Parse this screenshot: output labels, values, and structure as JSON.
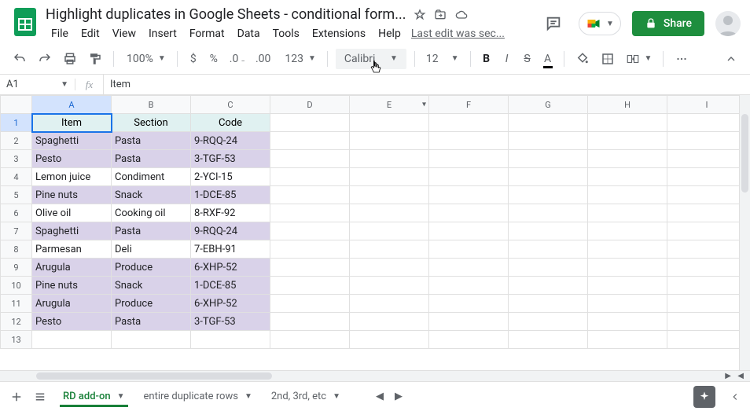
{
  "header": {
    "doc_title": "Highlight duplicates in Google Sheets - conditional form...",
    "last_edit": "Last edit was sec...",
    "share_label": "Share"
  },
  "menus": [
    "File",
    "Edit",
    "View",
    "Insert",
    "Format",
    "Data",
    "Tools",
    "Extensions",
    "Help"
  ],
  "toolbar": {
    "zoom": "100%",
    "font": "Calibri",
    "font_size": "12",
    "more_formats": "123"
  },
  "namebox": "A1",
  "formula": "Item",
  "columns": [
    "A",
    "B",
    "C",
    "D",
    "E",
    "F",
    "G",
    "H",
    "I"
  ],
  "rows_count": 13,
  "table": {
    "headers": [
      "Item",
      "Section",
      "Code"
    ],
    "data": [
      {
        "item": "Spaghetti",
        "section": "Pasta",
        "code": "9-RQQ-24",
        "dup": true
      },
      {
        "item": "Pesto",
        "section": "Pasta",
        "code": "3-TGF-53",
        "dup": true
      },
      {
        "item": "Lemon juice",
        "section": "Condiment",
        "code": "2-YCI-15",
        "dup": false
      },
      {
        "item": "Pine nuts",
        "section": "Snack",
        "code": "1-DCE-85",
        "dup": true
      },
      {
        "item": "Olive oil",
        "section": "Cooking oil",
        "code": "8-RXF-92",
        "dup": false
      },
      {
        "item": "Spaghetti",
        "section": "Pasta",
        "code": "9-RQQ-24",
        "dup": true
      },
      {
        "item": "Parmesan",
        "section": "Deli",
        "code": "7-EBH-91",
        "dup": false
      },
      {
        "item": "Arugula",
        "section": "Produce",
        "code": "6-XHP-52",
        "dup": true
      },
      {
        "item": "Pine nuts",
        "section": "Snack",
        "code": "1-DCE-85",
        "dup": true
      },
      {
        "item": "Arugula",
        "section": "Produce",
        "code": "6-XHP-52",
        "dup": true
      },
      {
        "item": "Pesto",
        "section": "Pasta",
        "code": "3-TGF-53",
        "dup": true
      }
    ]
  },
  "sheets": [
    {
      "name": "RD add-on",
      "active": true
    },
    {
      "name": "entire duplicate rows",
      "active": false
    },
    {
      "name": "2nd, 3rd, etc",
      "active": false
    }
  ]
}
